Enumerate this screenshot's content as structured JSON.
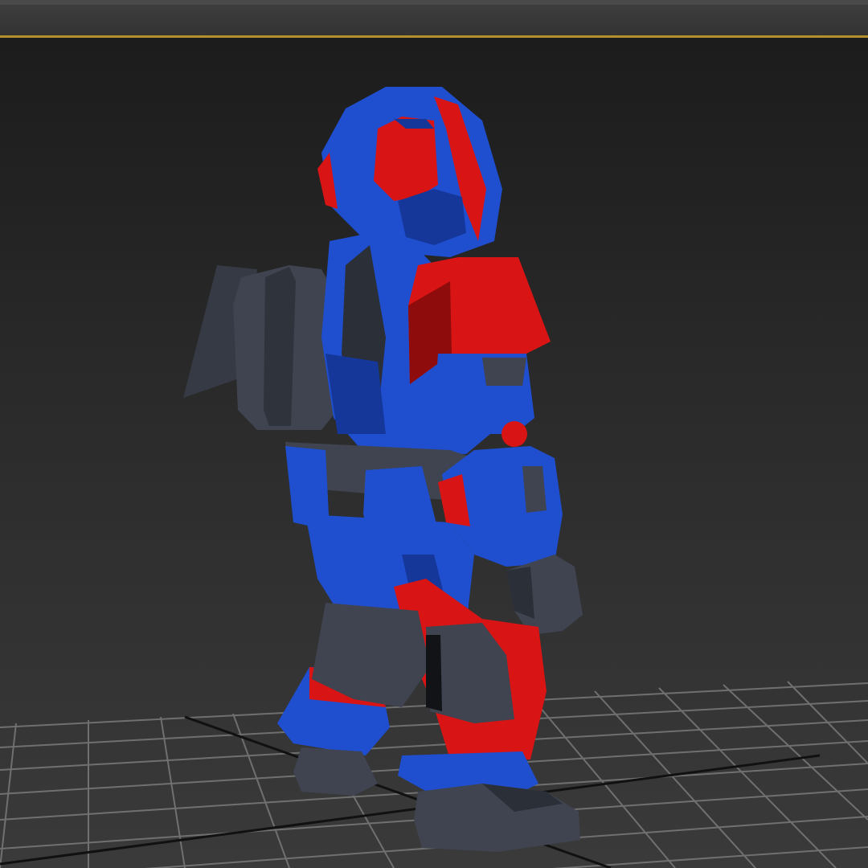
{
  "app": {
    "viewport": {
      "active_border_color": "#b38f2e",
      "background_top": "#1c1c1c",
      "background_bottom": "#3a3a3a",
      "grid_color": "#7a7a7a",
      "grid_axis_color": "#111111"
    },
    "model": {
      "name": "robot-figure",
      "colors": {
        "primary_blue": "#1f4fcf",
        "dark_blue": "#15379a",
        "red": "#d81414",
        "dark_red": "#8e0c0c",
        "grey": "#3f4450",
        "dark_grey": "#2b2f37"
      }
    }
  }
}
